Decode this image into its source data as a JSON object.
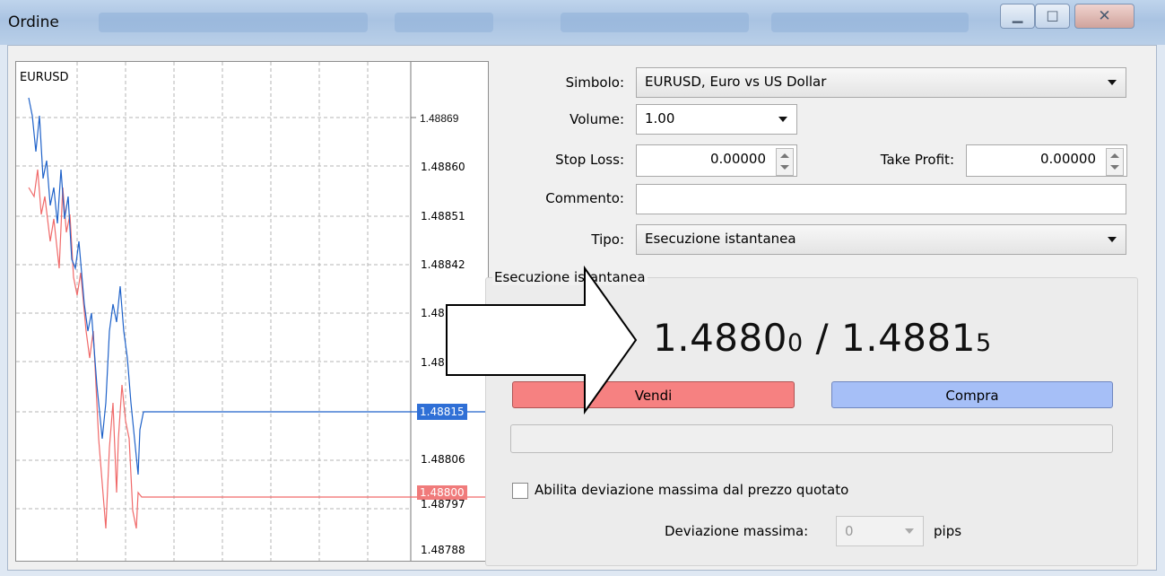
{
  "window": {
    "title": "Ordine",
    "controls": {
      "minimize": "minimize",
      "maximize": "maximize",
      "close": "close"
    }
  },
  "chart": {
    "symbol": "EURUSD",
    "price_scale": [
      "1.48869",
      "1.48860",
      "1.48851",
      "1.48842",
      "1.48",
      "1.48",
      "1.48806",
      "1.48797",
      "1.48788"
    ],
    "bid_badge": "1.48800",
    "ask_badge": "1.48815",
    "colors": {
      "ask_line": "#1f62c9",
      "bid_line": "#f06a6a",
      "ask_badge_bg": "#2f6fd6",
      "bid_badge_bg": "#f07b7b"
    }
  },
  "form": {
    "symbol_label": "Simbolo:",
    "symbol_value": "EURUSD, Euro vs US Dollar",
    "volume_label": "Volume:",
    "volume_value": "1.00",
    "stoploss_label": "Stop Loss:",
    "stoploss_value": "0.00000",
    "takeprofit_label": "Take Profit:",
    "takeprofit_value": "0.00000",
    "comment_label": "Commento:",
    "comment_value": "",
    "type_label": "Tipo:",
    "type_value": "Esecuzione istantanea"
  },
  "execution": {
    "group_title": "Esecuzione istantanea",
    "bid_main": "1.4880",
    "bid_last": "0",
    "separator": " / ",
    "ask_main": "1.4881",
    "ask_last": "5",
    "sell_label": "Vendi",
    "buy_label": "Compra",
    "deviation_checkbox": "Abilita deviazione massima dal prezzo quotato",
    "deviation_label": "Deviazione massima:",
    "deviation_value": "0",
    "deviation_unit": "pips"
  }
}
